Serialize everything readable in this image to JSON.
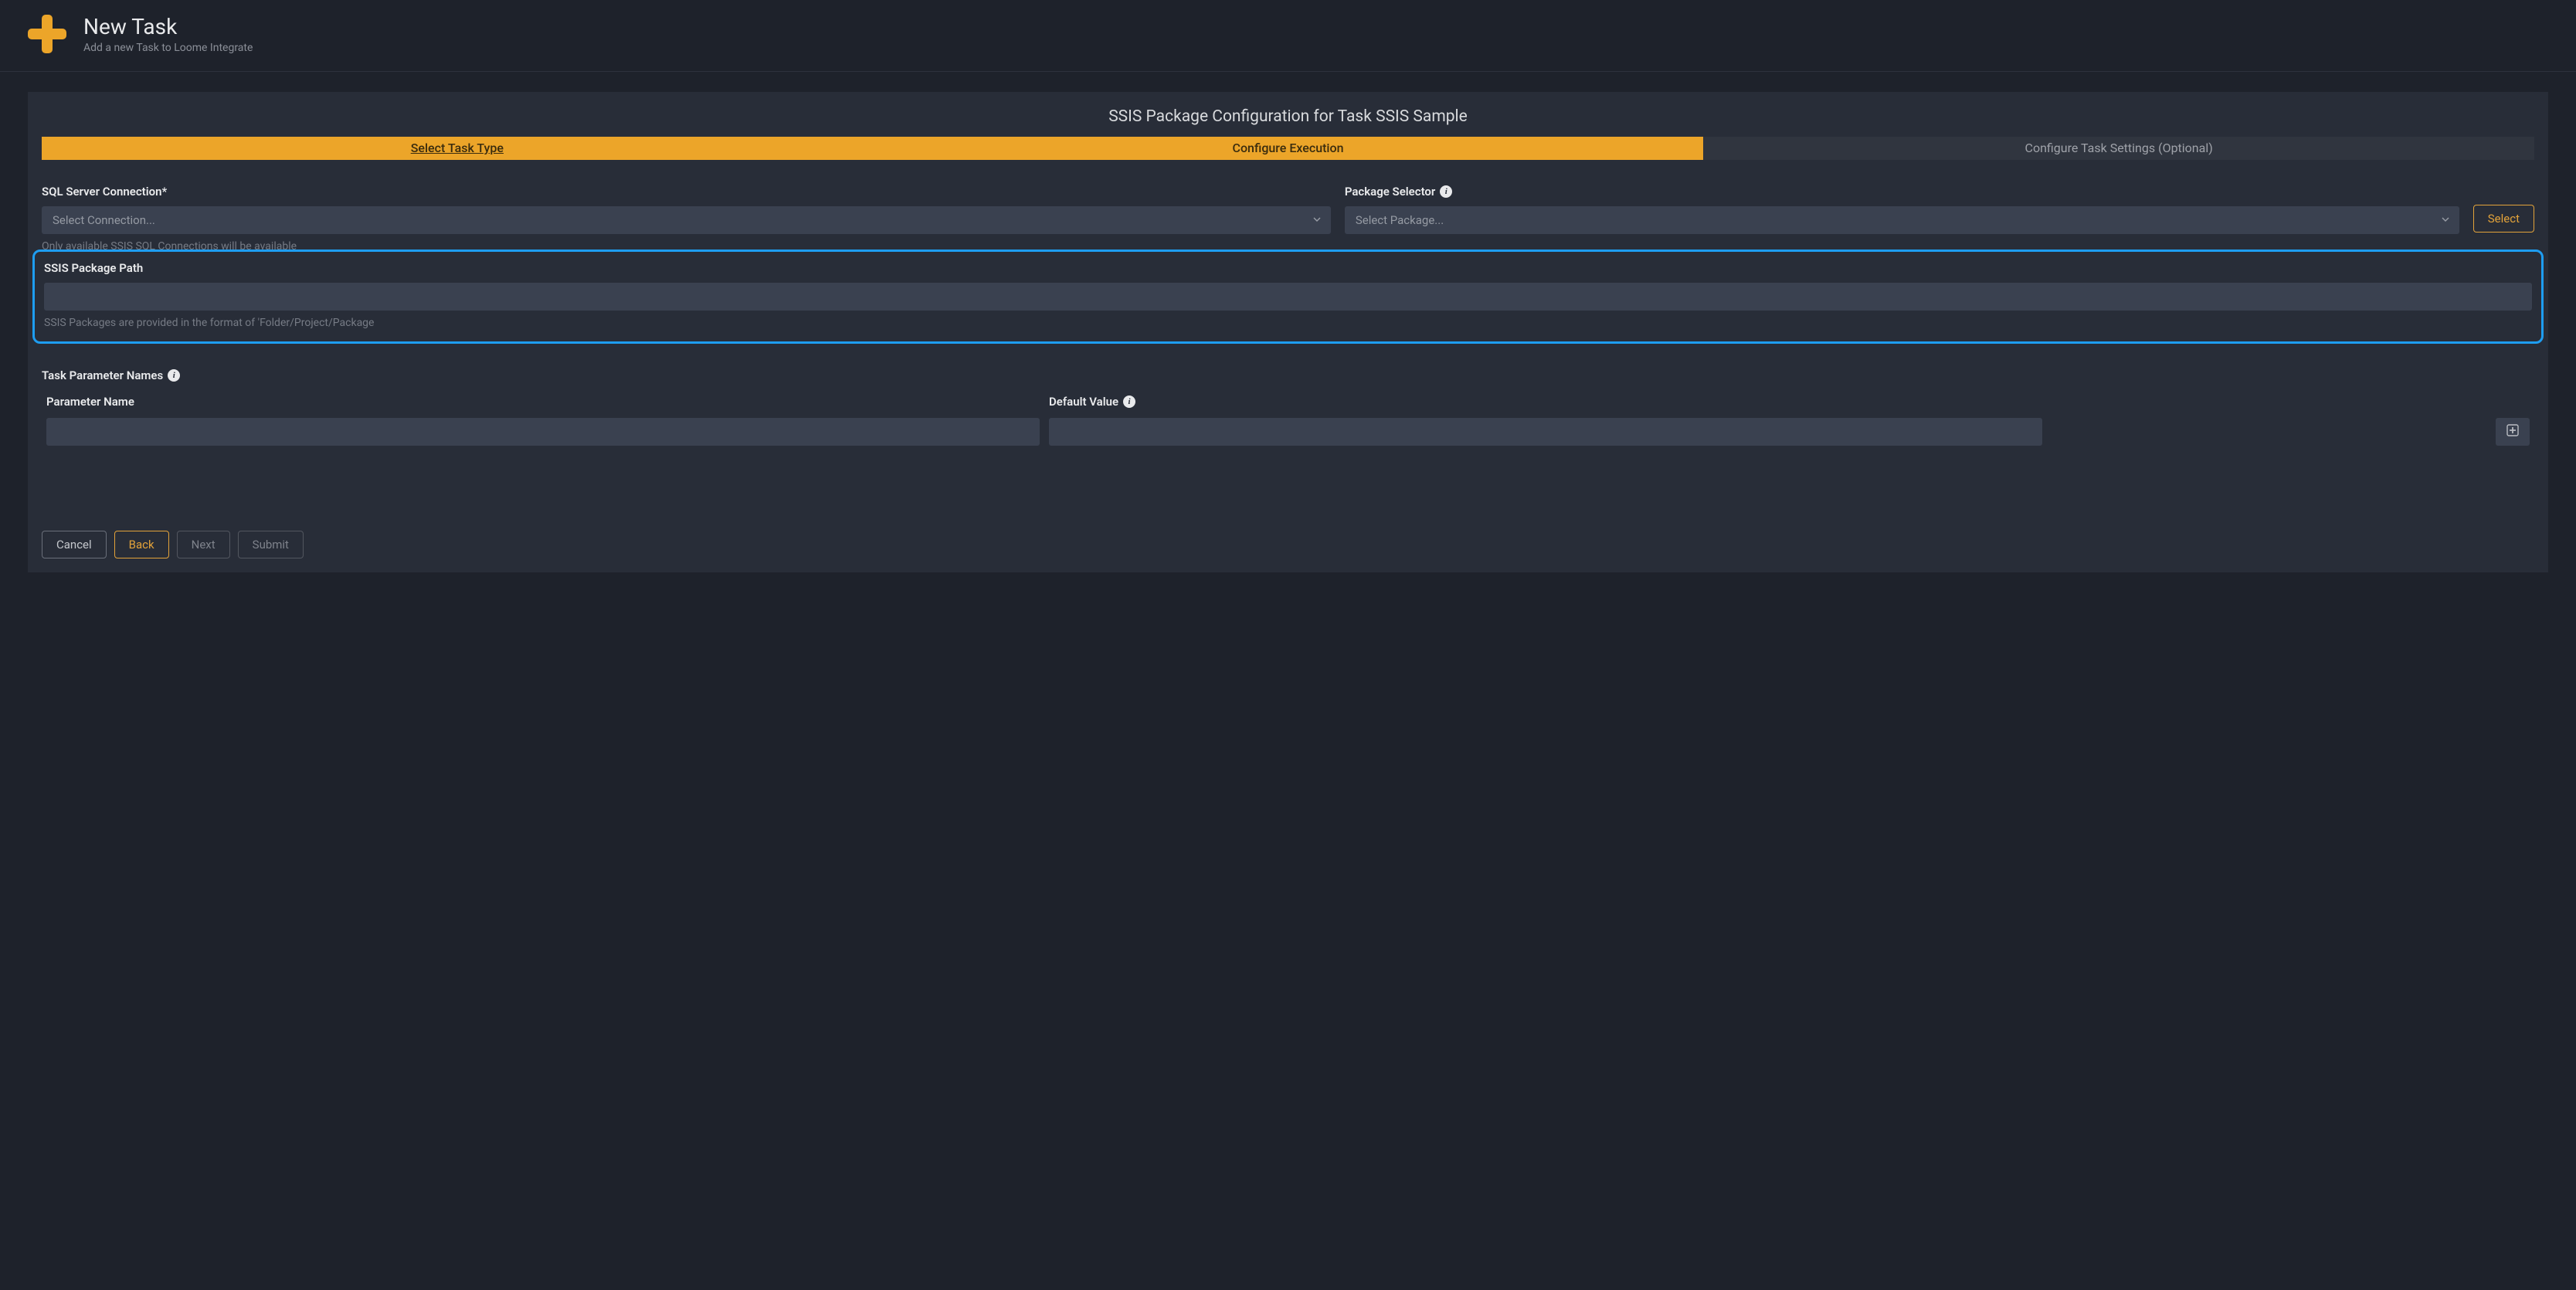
{
  "header": {
    "title": "New Task",
    "subtitle": "Add a new Task to Loome Integrate"
  },
  "panel": {
    "title": "SSIS Package Configuration for Task SSIS Sample"
  },
  "steps": {
    "select_type": "Select Task Type",
    "configure_exec": "Configure Execution",
    "configure_settings": "Configure Task Settings (Optional)"
  },
  "form": {
    "connection_label": "SQL Server Connection*",
    "connection_placeholder": "Select Connection...",
    "connection_helper": "Only available SSIS SQL Connections will be available",
    "package_label": "Package Selector",
    "package_placeholder": "Select Package...",
    "select_button": "Select",
    "path_label": "SSIS Package Path",
    "path_value": "",
    "path_helper": "SSIS Packages are provided in the format of 'Folder/Project/Package"
  },
  "params": {
    "section_label": "Task Parameter Names",
    "col_name": "Parameter Name",
    "col_default": "Default Value",
    "rows": [
      {
        "name": "",
        "default": ""
      }
    ]
  },
  "footer": {
    "cancel": "Cancel",
    "back": "Back",
    "next": "Next",
    "submit": "Submit"
  }
}
